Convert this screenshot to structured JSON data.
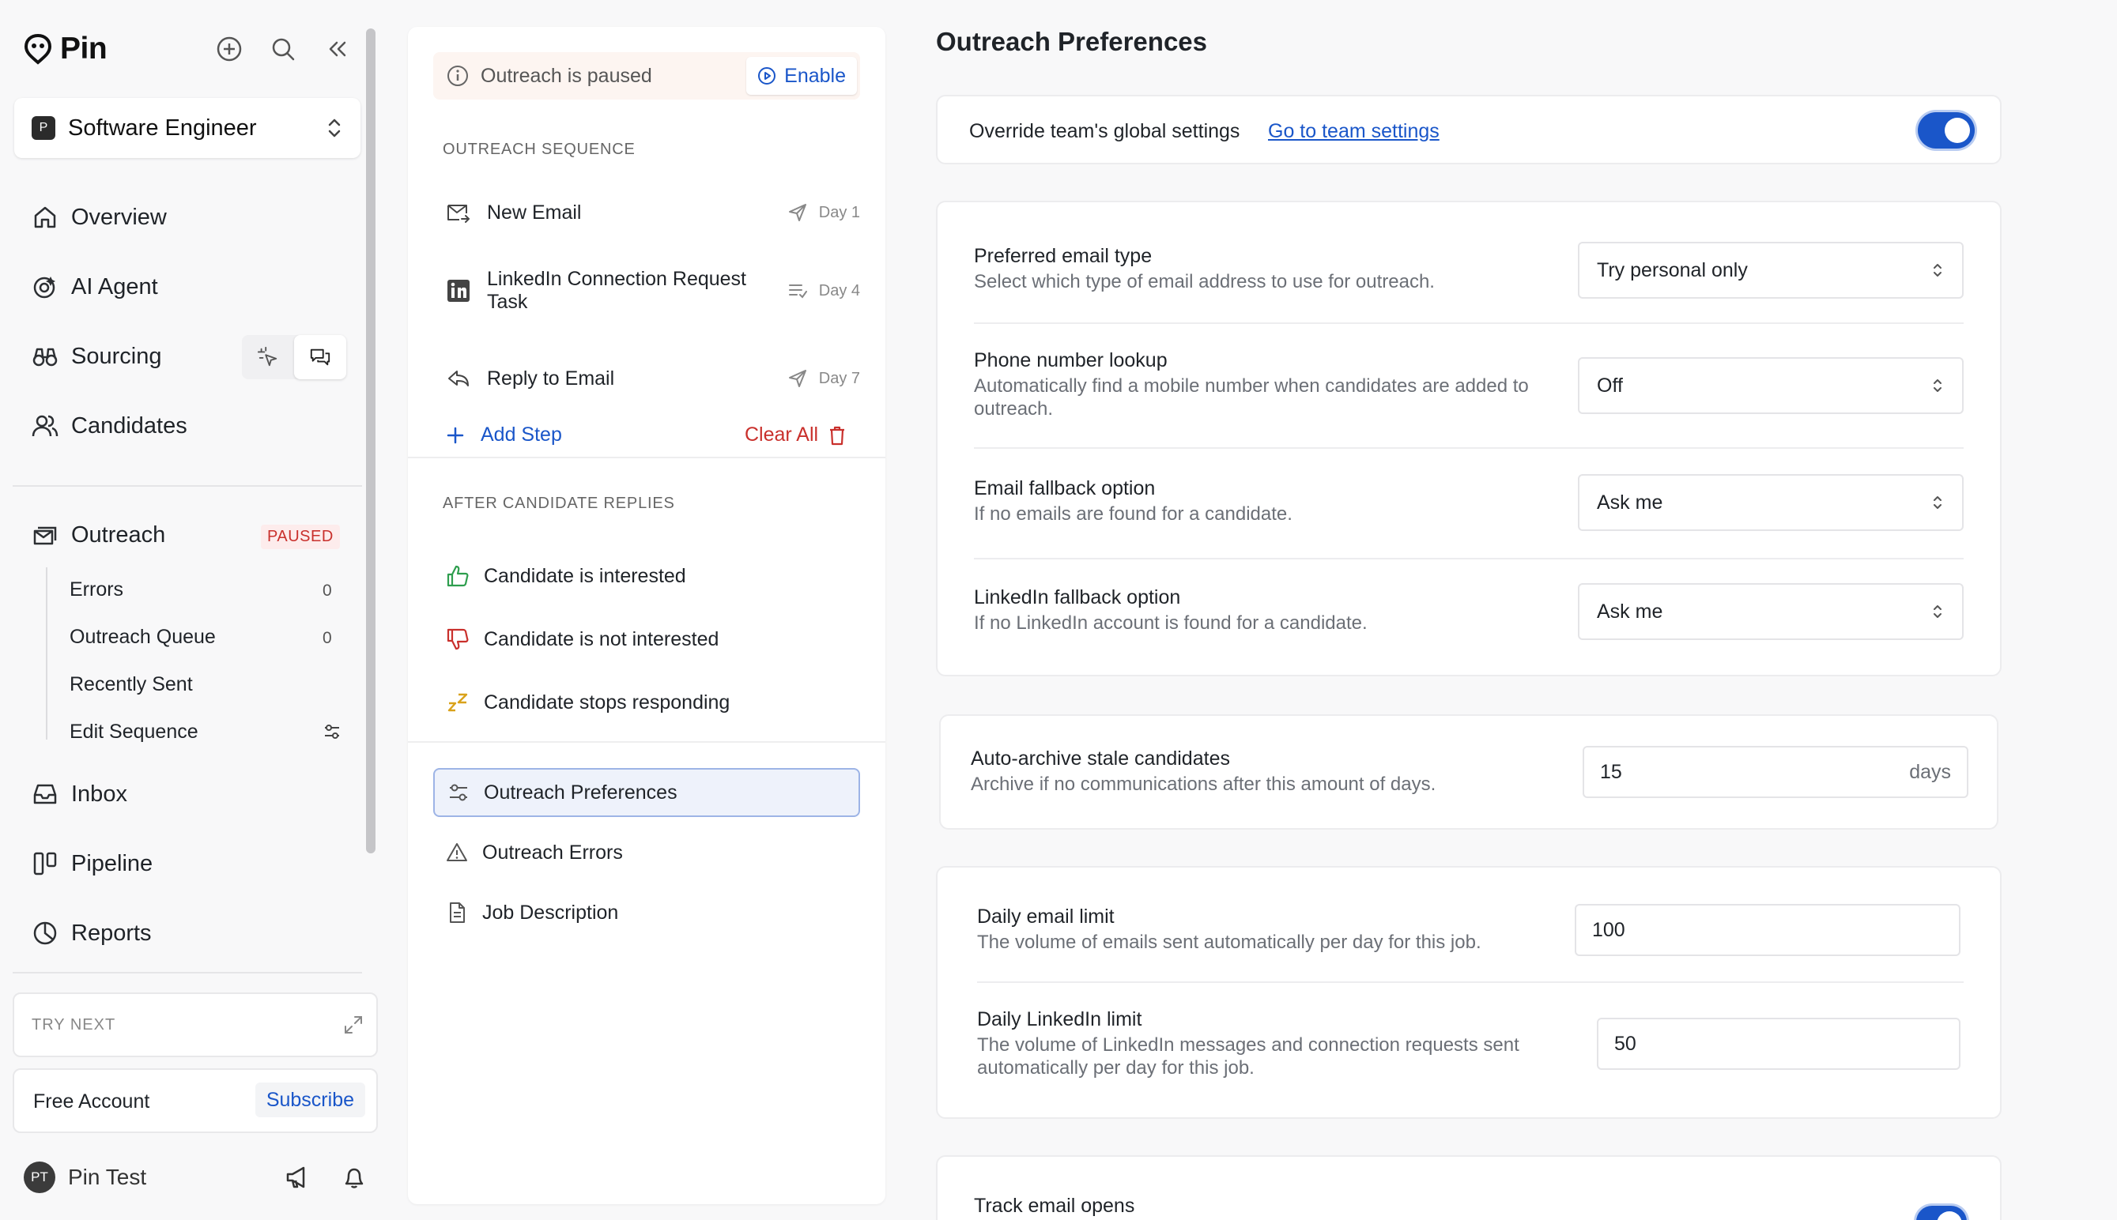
{
  "app": {
    "name": "Pin"
  },
  "sidebar": {
    "job": {
      "badge": "P",
      "label": "Software Engineer"
    },
    "nav": {
      "overview": "Overview",
      "ai_agent": "AI Agent",
      "sourcing": "Sourcing",
      "candidates": "Candidates",
      "outreach": "Outreach",
      "outreach_status": "PAUSED",
      "inbox": "Inbox",
      "pipeline": "Pipeline",
      "reports": "Reports"
    },
    "outreach_sub": [
      {
        "label": "Errors",
        "count": "0"
      },
      {
        "label": "Outreach Queue",
        "count": "0"
      },
      {
        "label": "Recently Sent"
      },
      {
        "label": "Edit Sequence"
      }
    ],
    "try_next": "TRY NEXT",
    "account": {
      "plan": "Free Account",
      "cta": "Subscribe"
    },
    "user": {
      "initials": "PT",
      "name": "Pin Test"
    }
  },
  "middle": {
    "status_text": "Outreach is paused",
    "enable_label": "Enable",
    "sequence_heading": "OUTREACH SEQUENCE",
    "steps": [
      {
        "label": "New Email",
        "day": "Day 1"
      },
      {
        "label": "LinkedIn Connection Request Task",
        "day": "Day 4"
      },
      {
        "label": "Reply to Email",
        "day": "Day 7"
      }
    ],
    "add_step": "Add Step",
    "clear_all": "Clear All",
    "replies_heading": "AFTER CANDIDATE REPLIES",
    "replies": [
      {
        "label": "Candidate is interested"
      },
      {
        "label": "Candidate is not interested"
      },
      {
        "label": "Candidate stops responding"
      }
    ],
    "pages": [
      {
        "label": "Outreach Preferences"
      },
      {
        "label": "Outreach Errors"
      },
      {
        "label": "Job Description"
      }
    ]
  },
  "preferences": {
    "title": "Outreach Preferences",
    "override": {
      "label": "Override team's global settings",
      "link": "Go to team settings",
      "enabled": true
    },
    "email_settings": [
      {
        "title": "Preferred email type",
        "desc": "Select which type of email address to use for outreach.",
        "value": "Try personal only"
      },
      {
        "title": "Phone number lookup",
        "desc": "Automatically find a mobile number when candidates are added to outreach.",
        "value": "Off"
      },
      {
        "title": "Email fallback option",
        "desc": "If no emails are found for a candidate.",
        "value": "Ask me"
      },
      {
        "title": "LinkedIn fallback option",
        "desc": "If no LinkedIn account is found for a candidate.",
        "value": "Ask me"
      }
    ],
    "archive": {
      "title": "Auto-archive stale candidates",
      "desc": "Archive if no communications after this amount of days.",
      "value": "15",
      "unit": "days"
    },
    "limits": [
      {
        "title": "Daily email limit",
        "desc": "The volume of emails sent automatically per day for this job.",
        "value": "100"
      },
      {
        "title": "Daily LinkedIn limit",
        "desc": "The volume of LinkedIn messages and connection requests sent automatically per day for this job.",
        "value": "50"
      }
    ],
    "tracking": {
      "title": "Track email opens",
      "enabled": true
    }
  },
  "colors": {
    "accent": "#1a56c9",
    "danger": "#c9302c",
    "success": "#2e9e4e"
  }
}
